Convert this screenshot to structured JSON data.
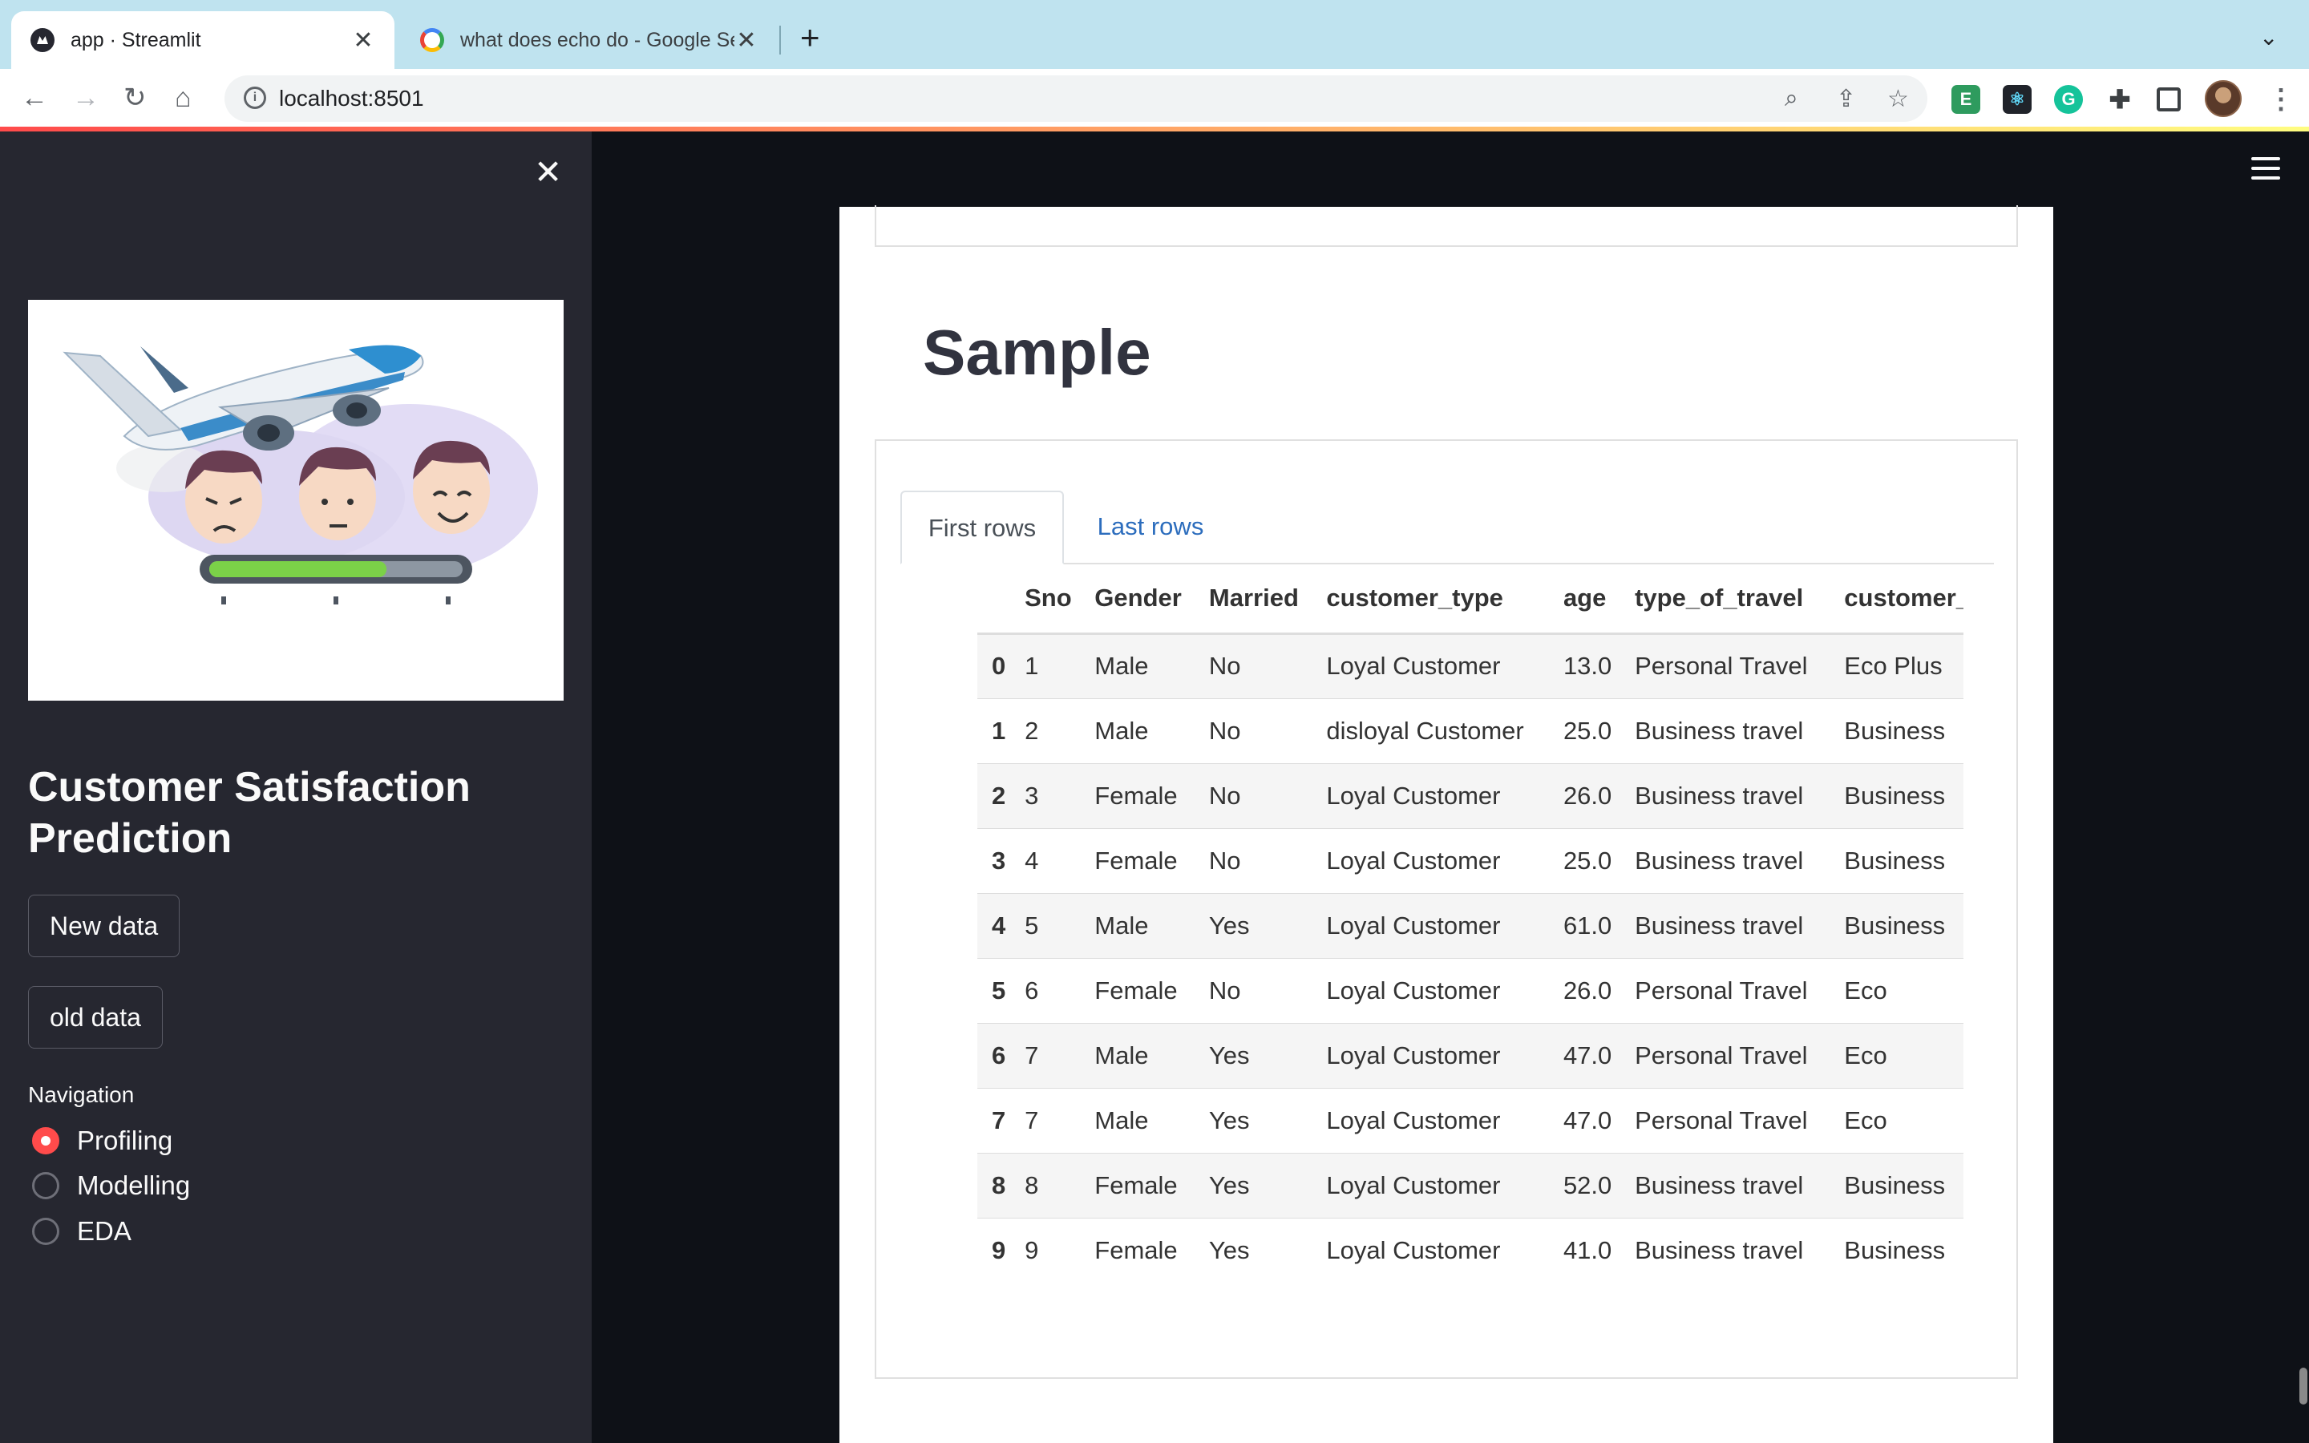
{
  "browser": {
    "tabs": [
      {
        "title": "app · Streamlit",
        "icon": "streamlit-icon"
      },
      {
        "title": "what does echo do - Google Se",
        "icon": "google-icon"
      }
    ],
    "close_glyph": "✕",
    "new_tab_glyph": "+",
    "url": "localhost:8501",
    "extensions": [
      "evernote-extension-icon",
      "react-devtools-icon",
      "grammarly-icon",
      "puzzle-icon"
    ]
  },
  "sidebar": {
    "title": "Customer Satisfaction Prediction",
    "buttons": [
      {
        "label": "New data"
      },
      {
        "label": "old data"
      }
    ],
    "navigation": {
      "label": "Navigation",
      "options": [
        "Profiling",
        "Modelling",
        "EDA"
      ],
      "selected": "Profiling"
    }
  },
  "main": {
    "heading": "Sample",
    "tabs": [
      {
        "label": "First rows",
        "active": true
      },
      {
        "label": "Last rows",
        "active": false
      }
    ],
    "table": {
      "columns": [
        "",
        "Sno",
        "Gender",
        "Married",
        "customer_type",
        "age",
        "type_of_travel",
        "customer_"
      ],
      "rows": [
        [
          "0",
          "1",
          "Male",
          "No",
          "Loyal Customer",
          "13.0",
          "Personal Travel",
          "Eco Plus"
        ],
        [
          "1",
          "2",
          "Male",
          "No",
          "disloyal Customer",
          "25.0",
          "Business travel",
          "Business"
        ],
        [
          "2",
          "3",
          "Female",
          "No",
          "Loyal Customer",
          "26.0",
          "Business travel",
          "Business"
        ],
        [
          "3",
          "4",
          "Female",
          "No",
          "Loyal Customer",
          "25.0",
          "Business travel",
          "Business"
        ],
        [
          "4",
          "5",
          "Male",
          "Yes",
          "Loyal Customer",
          "61.0",
          "Business travel",
          "Business"
        ],
        [
          "5",
          "6",
          "Female",
          "No",
          "Loyal Customer",
          "26.0",
          "Personal Travel",
          "Eco"
        ],
        [
          "6",
          "7",
          "Male",
          "Yes",
          "Loyal Customer",
          "47.0",
          "Personal Travel",
          "Eco"
        ],
        [
          "7",
          "7",
          "Male",
          "Yes",
          "Loyal Customer",
          "47.0",
          "Personal Travel",
          "Eco"
        ],
        [
          "8",
          "8",
          "Female",
          "Yes",
          "Loyal Customer",
          "52.0",
          "Business travel",
          "Business"
        ],
        [
          "9",
          "9",
          "Female",
          "Yes",
          "Loyal Customer",
          "41.0",
          "Business travel",
          "Business"
        ]
      ]
    }
  },
  "colors": {
    "primary": "#ff4b4b",
    "sidebar_bg": "#262730",
    "app_bg": "#0e1117",
    "tab_link": "#2c6dbd",
    "browser_tabbar": "#bfe3ef"
  },
  "illustration": {
    "progress_level": 0.7
  }
}
